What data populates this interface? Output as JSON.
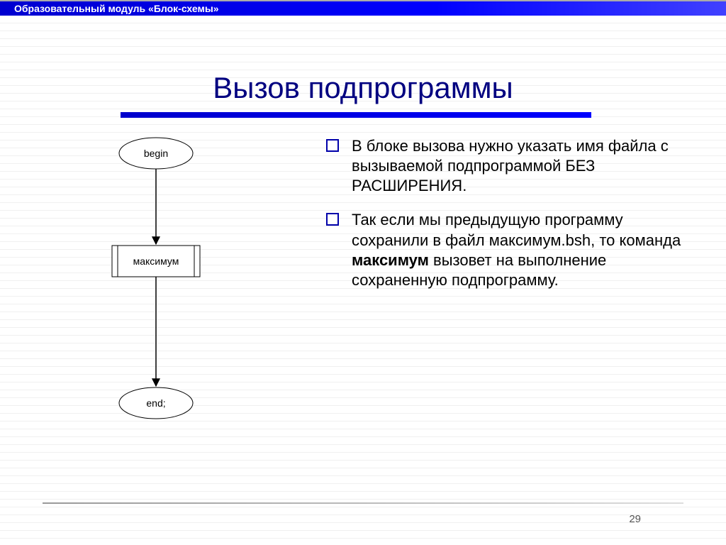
{
  "header_bar": "Образовательный модуль «Блок-схемы»",
  "title": "Вызов подпрограммы",
  "flow": {
    "begin": "begin",
    "call_box": "максимум",
    "end": "end;"
  },
  "bullets": {
    "b1": "В блоке вызова нужно указать имя файла с вызываемой подпрограммой БЕЗ РАСШИРЕНИЯ.",
    "b2_pre": "Так если мы предыдущую программу сохранили в файл максимум.bsh, то команда ",
    "b2_bold": "максимум",
    "b2_post": " вызовет на выполнение сохраненную подпрограмму."
  },
  "page_number": "29",
  "chart_data": {
    "type": "flowchart",
    "nodes": [
      {
        "id": "n1",
        "shape": "terminator",
        "label": "begin"
      },
      {
        "id": "n2",
        "shape": "predefined-process",
        "label": "максимум"
      },
      {
        "id": "n3",
        "shape": "terminator",
        "label": "end;"
      }
    ],
    "edges": [
      {
        "from": "n1",
        "to": "n2"
      },
      {
        "from": "n2",
        "to": "n3"
      }
    ]
  }
}
